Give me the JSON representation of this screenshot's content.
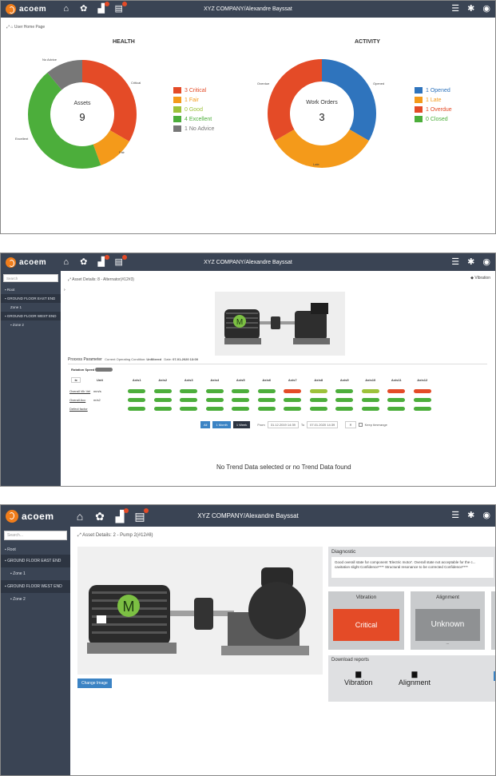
{
  "app": {
    "logo_text": "acoem",
    "user_title": "XYZ COMPANY/Alexandre Bayssat",
    "user_title_2": "XYZ COMPANY/Alexandre Bayssat"
  },
  "panel1": {
    "breadcrumb": "User Home Page",
    "health": {
      "title": "HEALTH",
      "center_label": "Assets",
      "center_value": "9",
      "slice_labels": {
        "critical": "Critical",
        "fair": "Fair",
        "excellent": "Excellent",
        "noadvice": "No Advice"
      },
      "legend": [
        {
          "text": "3 Critical",
          "color": "#e44b27"
        },
        {
          "text": "1 Fair",
          "color": "#f49a1a"
        },
        {
          "text": "0 Good",
          "color": "#9dc23a"
        },
        {
          "text": "4 Excellent",
          "color": "#4cae3b"
        },
        {
          "text": "1 No Advice",
          "color": "#777777"
        }
      ]
    },
    "activity": {
      "title": "ACTIVITY",
      "center_label": "Work Orders",
      "center_value": "3",
      "slice_labels": {
        "opened": "Opened",
        "late": "Late",
        "overdue": "Overdue"
      },
      "legend": [
        {
          "text": "1 Opened",
          "color": "#2f74bd"
        },
        {
          "text": "1 Late",
          "color": "#f49a1a"
        },
        {
          "text": "1 Overdue",
          "color": "#e44b27"
        },
        {
          "text": "0 Closed",
          "color": "#4cae3b"
        }
      ]
    }
  },
  "chart_data": [
    {
      "type": "pie",
      "title": "HEALTH",
      "categories": [
        "Critical",
        "Fair",
        "Good",
        "Excellent",
        "No Advice"
      ],
      "values": [
        3,
        1,
        0,
        4,
        1
      ]
    },
    {
      "type": "pie",
      "title": "ACTIVITY",
      "categories": [
        "Opened",
        "Late",
        "Overdue",
        "Closed"
      ],
      "values": [
        1,
        1,
        1,
        0
      ]
    }
  ],
  "panel2": {
    "search_placeholder": "Search",
    "sidebar": [
      "Root",
      "GROUND FLOOR EAST END",
      "Zone 1",
      "GROUND FLOOR WEST END",
      "Zone 2"
    ],
    "breadcrumb": "Asset Details: 8 - Alternator(#12#3)",
    "vibration_link": "Vibration",
    "process_parameter": "Process Parameter",
    "current_condition_label": "Current Operating Condition:",
    "current_condition_value": "Unfiltered",
    "date_label": "Date:",
    "date_value": "07-01-2020 13:00",
    "rotation_speed": "Rotation Speed",
    "unit_col": "Unit",
    "axis_headers": [
      "Axis1",
      "Axis2",
      "Axis3",
      "Axis4",
      "Axis5",
      "Axis6",
      "Axis7",
      "Axis8",
      "Axis9",
      "Axis10",
      "Axis11",
      "Axis12"
    ],
    "rows": [
      {
        "label": "Overall Vib Vel",
        "unit": "mm/s",
        "colors": [
          "g",
          "g",
          "g",
          "g",
          "g",
          "g",
          "r",
          "y",
          "g",
          "y",
          "r",
          "r"
        ]
      },
      {
        "label": "Overall Acc",
        "unit": "m/s2",
        "colors": [
          "g",
          "g",
          "g",
          "g",
          "g",
          "g",
          "g",
          "g",
          "g",
          "g",
          "g",
          "g"
        ]
      },
      {
        "label": "Defect factor",
        "unit": "",
        "colors": [
          "g",
          "g",
          "g",
          "g",
          "g",
          "g",
          "g",
          "g",
          "g",
          "g",
          "g",
          "g"
        ]
      }
    ],
    "range_buttons": [
      "All",
      "1 Month",
      "1 Week"
    ],
    "from_label": "From",
    "from_value": "31.12.2019 14:39",
    "to_label": "To",
    "to_value": "07.01.2020 14:39",
    "keep_label": "Keep timerange",
    "no_data": "No Trend Data selected or no Trend Data found",
    "motor_letter": "M"
  },
  "panel3": {
    "search_placeholder": "Search...",
    "sidebar": [
      "Root",
      "GROUND FLOOR EAST END",
      "Zone 1",
      "GROUND FLOOR WEST END",
      "Zone 2"
    ],
    "breadcrumb": "Asset Details: 2 - Pump 2(#12#8)",
    "change_image": "Change Image",
    "diagnostic_title": "Diagnostic",
    "diagnostic_text": "Good overall state for component 'Electric motor'. Overall state not acceptable for the c... cavitation slight Confidence**** Structural resonance to be corrected Confidence****",
    "vibration_title": "Vibration",
    "vibration_status": "Critical",
    "alignment_title": "Alignment",
    "alignment_status": "Unknown",
    "alignment_sub": "...",
    "download_title": "Download reports",
    "download_items": [
      "Vibration",
      "Alignment"
    ],
    "motor_letter": "M"
  },
  "colors": {
    "topbar": "#3a4454",
    "critical": "#e44b27",
    "accent": "#f07d1b"
  }
}
